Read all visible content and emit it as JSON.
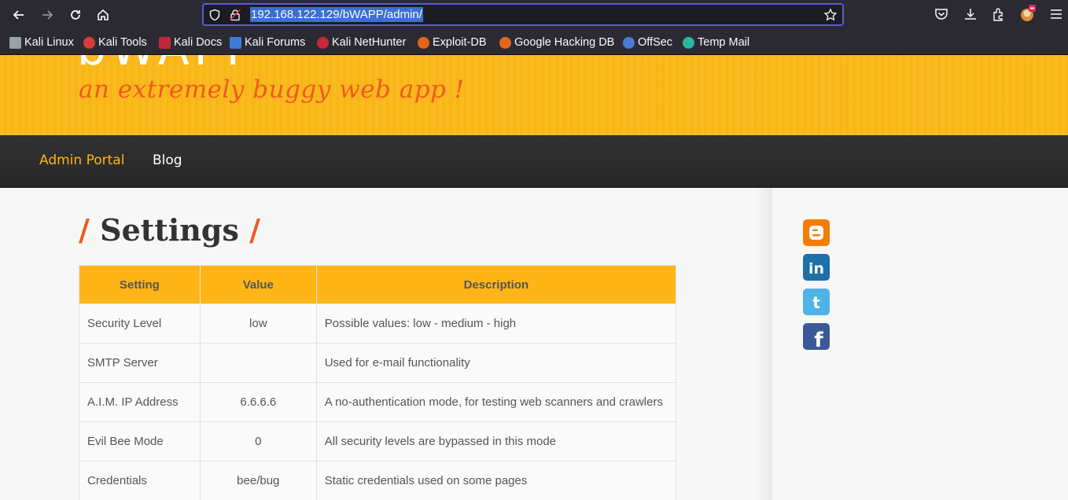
{
  "browser": {
    "url": "192.168.122.129/bWAPP/admin/",
    "bookmarks": [
      {
        "label": "Kali Linux",
        "icon": "kali-dragon-icon",
        "color": "#9aa0a6"
      },
      {
        "label": "Kali Tools",
        "icon": "kali-tools-icon",
        "color": "#d63d3d"
      },
      {
        "label": "Kali Docs",
        "icon": "kali-docs-icon",
        "color": "#c0283a"
      },
      {
        "label": "Kali Forums",
        "icon": "kali-forums-icon",
        "color": "#3d7bd6"
      },
      {
        "label": "Kali NetHunter",
        "icon": "nethunter-icon",
        "color": "#c8283a"
      },
      {
        "label": "Exploit-DB",
        "icon": "exploit-db-icon",
        "color": "#e2651f"
      },
      {
        "label": "Google Hacking DB",
        "icon": "ghdb-icon",
        "color": "#e2651f"
      },
      {
        "label": "OffSec",
        "icon": "offsec-icon",
        "color": "#4a7bd6"
      },
      {
        "label": "Temp Mail",
        "icon": "temp-mail-icon",
        "color": "#2bb5a0"
      }
    ]
  },
  "header": {
    "logo_text": "bWAPP",
    "tagline": "an extremely buggy web app !"
  },
  "nav": {
    "items": [
      {
        "label": "Admin Portal",
        "active": true
      },
      {
        "label": "Blog",
        "active": false
      }
    ]
  },
  "main": {
    "title_slash": "/",
    "title": "Settings",
    "table": {
      "headers": [
        "Setting",
        "Value",
        "Description"
      ],
      "rows": [
        [
          "Security Level",
          "low",
          "Possible values: low - medium - high"
        ],
        [
          "SMTP Server",
          "",
          "Used for e-mail functionality"
        ],
        [
          "A.I.M. IP Address",
          "6.6.6.6",
          "A no-authentication mode, for testing web scanners and crawlers"
        ],
        [
          "Evil Bee Mode",
          "0",
          "All security levels are bypassed in this mode"
        ],
        [
          "Credentials",
          "bee/bug",
          "Static credentials used on some pages"
        ]
      ]
    }
  },
  "sidebar": {
    "social": [
      {
        "icon": "blogger-icon",
        "color": "#f57d00"
      },
      {
        "icon": "linkedin-icon",
        "color": "#1f6fa8",
        "text": "in"
      },
      {
        "icon": "twitter-icon",
        "color": "#4fb3e6"
      },
      {
        "icon": "facebook-icon",
        "color": "#3b5998",
        "text": "f"
      }
    ]
  },
  "colors": {
    "accent_yellow": "#ffb515",
    "accent_orange": "#ef5a1e",
    "nav_bg": "#2d2d2d"
  }
}
